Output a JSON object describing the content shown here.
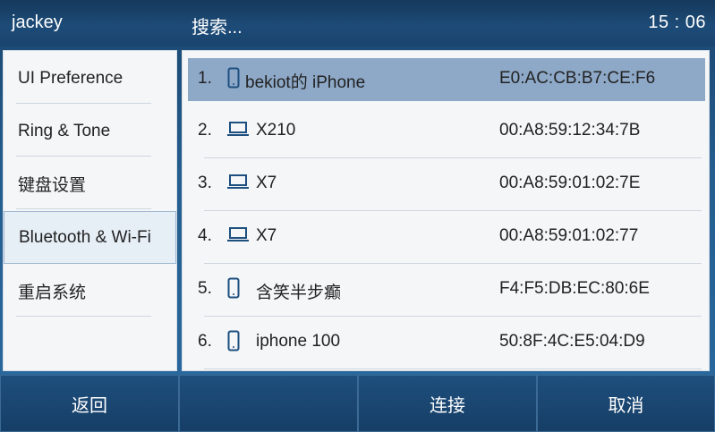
{
  "header": {
    "user": "jackey",
    "title": "搜索...",
    "time": "15 : 06"
  },
  "sidebar": {
    "items": [
      {
        "label": "UI Preference"
      },
      {
        "label": "Ring & Tone"
      },
      {
        "label": "键盘设置"
      },
      {
        "label": "Bluetooth & Wi-Fi",
        "selected": true
      },
      {
        "label": "重启系统"
      }
    ]
  },
  "devices": [
    {
      "index": "1.",
      "icon": "phone-icon",
      "name": "bekiot的 iPhone",
      "mac": "E0:AC:CB:B7:CE:F6",
      "selected": true
    },
    {
      "index": "2.",
      "icon": "laptop-icon",
      "name": "X210",
      "mac": "00:A8:59:12:34:7B"
    },
    {
      "index": "3.",
      "icon": "laptop-icon",
      "name": "X7",
      "mac": "00:A8:59:01:02:7E"
    },
    {
      "index": "4.",
      "icon": "laptop-icon",
      "name": "X7",
      "mac": "00:A8:59:01:02:77"
    },
    {
      "index": "5.",
      "icon": "phone-icon",
      "name": "含笑半步癫",
      "mac": "F4:F5:DB:EC:80:6E"
    },
    {
      "index": "6.",
      "icon": "phone-icon",
      "name": "iphone 100",
      "mac": "50:8F:4C:E5:04:D9"
    }
  ],
  "softkeys": {
    "back": "返回",
    "empty": "",
    "connect": "连接",
    "cancel": "取消"
  },
  "colors": {
    "selected_row": "#8ea9c8",
    "icon": "#1d4f7f"
  }
}
